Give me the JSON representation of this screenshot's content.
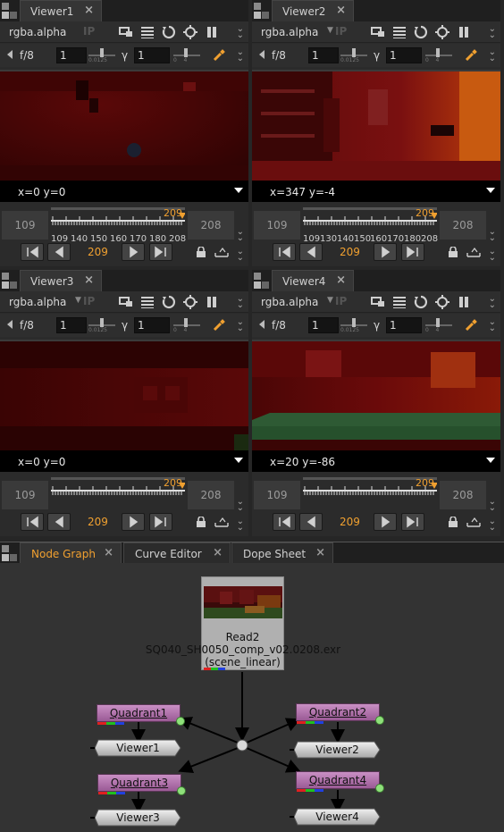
{
  "viewers": [
    {
      "tab": "Viewer1",
      "channel": "rgba.alpha",
      "ip": "IP",
      "fstop": "f/8",
      "gain": "1",
      "gamma_symbol": "γ",
      "gamma": "1",
      "coords": "x=0 y=0",
      "in_frame": "109",
      "out_frame": "208",
      "current_frame": "209",
      "ruler_labels": [
        "109",
        "140",
        "150",
        "160",
        "170",
        "180",
        "208"
      ],
      "image": "dark-red"
    },
    {
      "tab": "Viewer2",
      "channel": "rgba.alpha",
      "ip": "IP",
      "fstop": "f/8",
      "gain": "1",
      "gamma_symbol": "γ",
      "gamma": "1",
      "coords": "x=347 y=-4",
      "in_frame": "109",
      "out_frame": "208",
      "current_frame": "209",
      "ruler_labels": [
        "109",
        "130",
        "140",
        "150",
        "160",
        "170",
        "180",
        "208"
      ],
      "image": "red-room"
    },
    {
      "tab": "Viewer3",
      "channel": "rgba.alpha",
      "ip": "IP",
      "fstop": "f/8",
      "gain": "1",
      "gamma_symbol": "γ",
      "gamma": "1",
      "coords": "x=0 y=0",
      "in_frame": "109",
      "out_frame": "208",
      "current_frame": "209",
      "ruler_labels": [],
      "image": "dark-red-2"
    },
    {
      "tab": "Viewer4",
      "channel": "rgba.alpha",
      "ip": "IP",
      "fstop": "f/8",
      "gain": "1",
      "gamma_symbol": "γ",
      "gamma": "1",
      "coords": "x=20 y=-86",
      "in_frame": "109",
      "out_frame": "208",
      "current_frame": "209",
      "ruler_labels": [],
      "image": "red-floor"
    }
  ],
  "node_graph": {
    "tabs": [
      {
        "label": "Node Graph",
        "active": true
      },
      {
        "label": "Curve Editor",
        "active": false
      },
      {
        "label": "Dope Sheet",
        "active": false
      }
    ],
    "read_node": {
      "title": "Read2",
      "file": "SQ040_SH0050_comp_v02.0208.exr",
      "colorspace": "(scene_linear)"
    },
    "quadrants": [
      "Quadrant1",
      "Quadrant2",
      "Quadrant3",
      "Quadrant4"
    ],
    "viewer_nodes": [
      "Viewer1",
      "Viewer2",
      "Viewer3",
      "Viewer4"
    ]
  },
  "colors": {
    "accent": "#f0a030",
    "quadrant_node": "#b774b0",
    "read_node": "#b0b0b0",
    "panel_bg": "#2b2b2b"
  }
}
